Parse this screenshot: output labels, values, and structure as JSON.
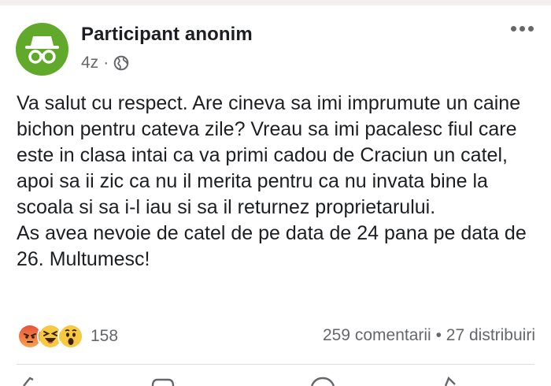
{
  "post": {
    "author": "Participant anonim",
    "time": "4z",
    "separator": "·",
    "privacy_icon": "globe-icon",
    "menu_icon": "more-dots-icon",
    "avatar_icon": "incognito-icon",
    "paragraphs": [
      "Va salut cu respect. Are cineva sa imi imprumute un caine bichon pentru cateva zile? Vreau sa imi pacalesc fiul care este in clasa intai ca va primi cadou de Craciun un catel, apoi sa ii zic ca nu il merita pentru ca nu invata bine la scoala si sa i-l iau si sa il returnez proprietarului.",
      "As avea nevoie de catel de pe data de 24 pana pe data de 26. Multumesc!"
    ]
  },
  "engagement": {
    "reactions": [
      "angry",
      "haha",
      "wow"
    ],
    "reaction_count": "158",
    "comments": "259 comentarii",
    "dot": "•",
    "shares": "27 distribuiri"
  },
  "actions": [
    "like-icon",
    "comment-icon",
    "messenger-icon",
    "share-icon"
  ],
  "colors": {
    "avatar_bg": "#60a92a",
    "text": "#1c1e21",
    "muted": "#65676b",
    "angry": "#f0684a",
    "haha": "#f7c842"
  }
}
